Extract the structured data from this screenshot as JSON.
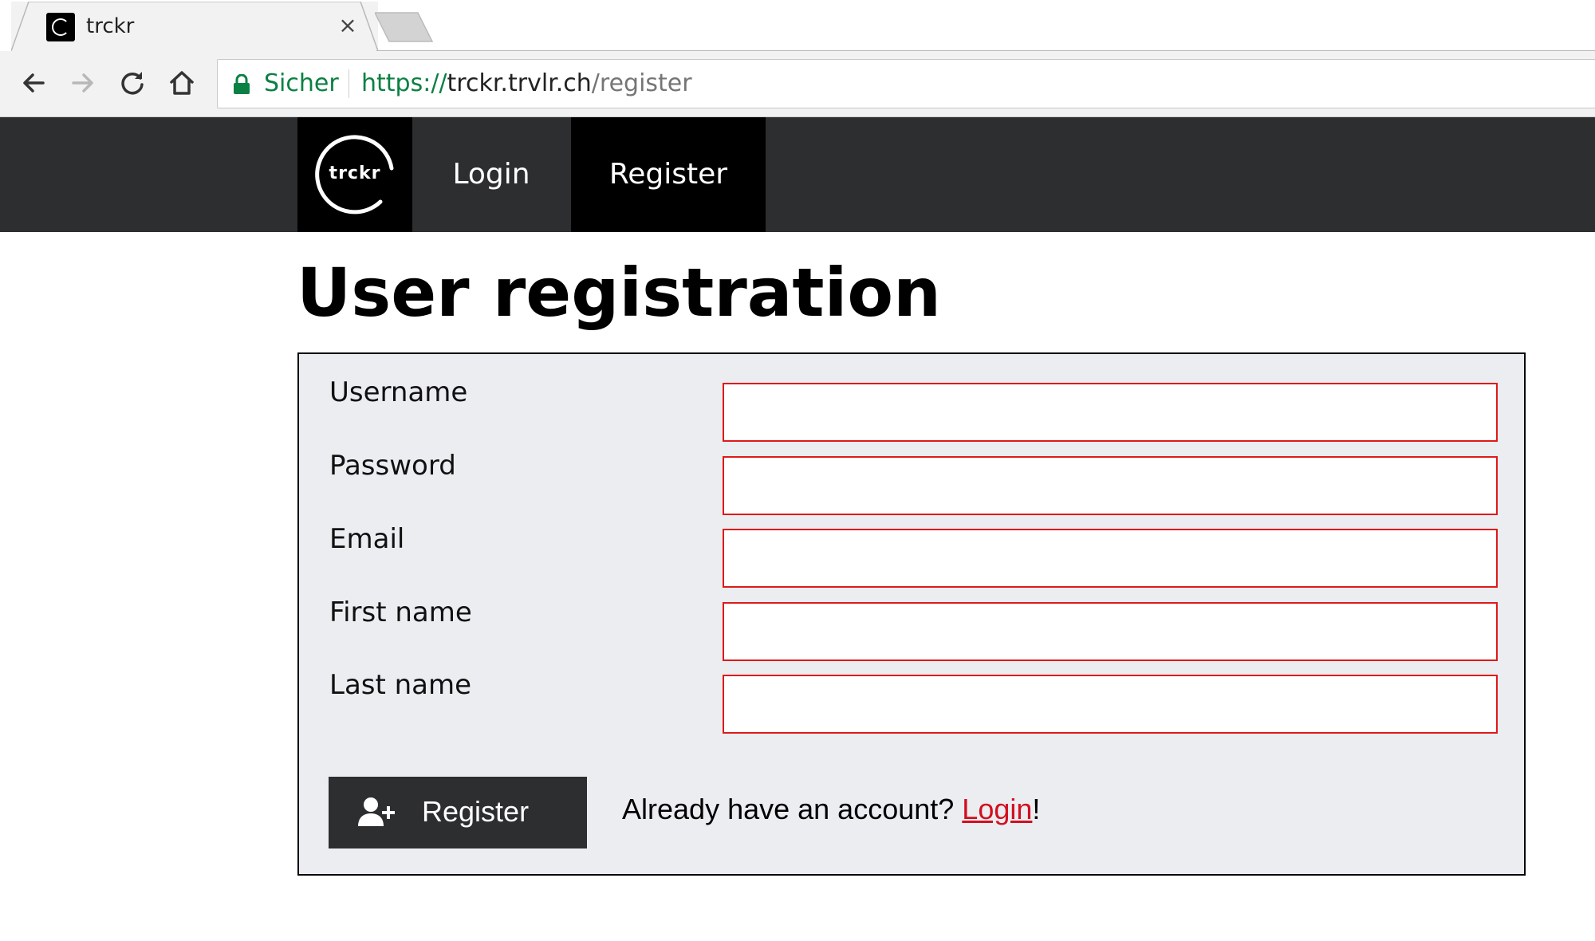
{
  "browser": {
    "tab_title": "trckr",
    "tab_close_glyph": "×",
    "security_label": "Sicher",
    "url_scheme": "https://",
    "url_host": "trckr.trvlr.ch",
    "url_path": "/register",
    "icons": [
      "back-arrow-icon",
      "forward-arrow-icon",
      "reload-icon",
      "home-icon",
      "lock-icon",
      "close-icon"
    ]
  },
  "nav": {
    "brand": "trckr",
    "links": [
      {
        "label": "Login",
        "active": false
      },
      {
        "label": "Register",
        "active": true
      }
    ]
  },
  "page": {
    "title": "User registration"
  },
  "form": {
    "fields": [
      {
        "label": "Username",
        "value": "",
        "invalid": true
      },
      {
        "label": "Password",
        "value": "",
        "invalid": true
      },
      {
        "label": "Email",
        "value": "",
        "invalid": true
      },
      {
        "label": "First name",
        "value": "",
        "invalid": true
      },
      {
        "label": "Last name",
        "value": "",
        "invalid": true
      }
    ],
    "submit_label": "Register",
    "submit_icon": "user-plus-icon",
    "hint_prefix": "Already have an account? ",
    "hint_link": "Login",
    "hint_suffix": "!"
  },
  "colors": {
    "nav_bg": "#2d2e30",
    "active_nav_bg": "#000000",
    "panel_bg": "#ebedf1",
    "invalid_border": "#e01919",
    "link": "#d20f1f",
    "secure_green": "#0b8043"
  }
}
